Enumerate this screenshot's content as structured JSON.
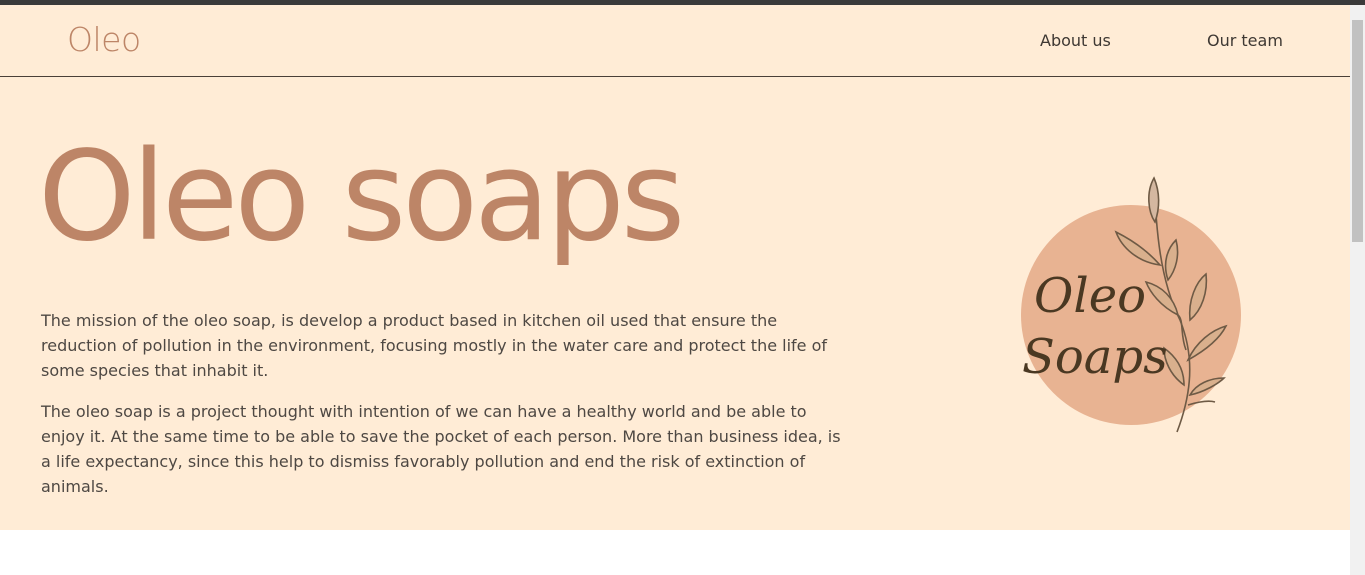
{
  "header": {
    "brand": "Oleo",
    "nav": [
      {
        "label": "About us"
      },
      {
        "label": "Our team"
      }
    ]
  },
  "hero": {
    "title": "Oleo soaps",
    "paragraphs": [
      "The mission of the oleo soap, is develop a product based in kitchen oil used that ensure the reduction of pollution in the environment, focusing mostly in the water care and protect the life of some species that inhabit it.",
      "The oleo soap is a project thought with intention of we can have a healthy world and be able to enjoy it. At the same time to be able to save the pocket of each person. More than business idea, is a life expectancy, since this help to dismiss favorably pollution and end the risk of extinction of animals."
    ]
  },
  "logo": {
    "line1": "Oleo",
    "line2": "Soaps"
  },
  "colors": {
    "background": "#ffecd6",
    "accent": "#bd8567",
    "logo_circle": "#e8b392",
    "text": "#4e4843"
  }
}
